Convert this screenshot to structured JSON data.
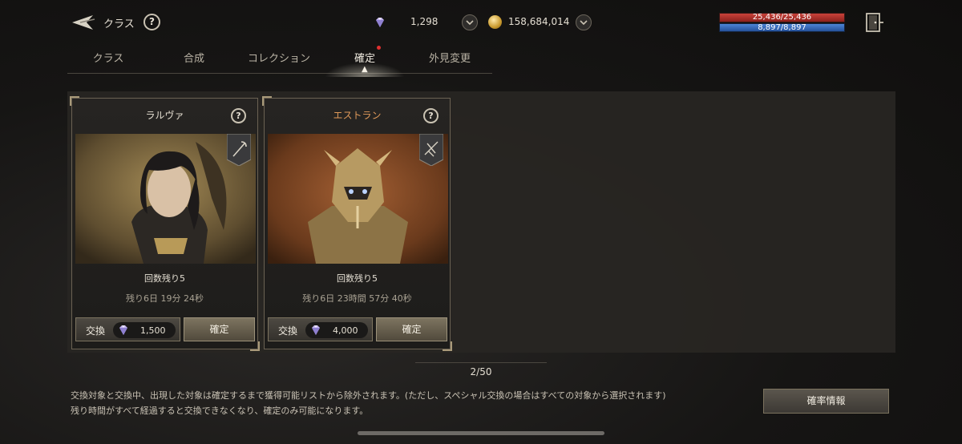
{
  "header": {
    "title": "クラス",
    "help": "?",
    "gems": "1,298",
    "gold": "158,684,014",
    "hp": "25,436/25,436",
    "mp": "8,897/8,897"
  },
  "tabs": [
    {
      "label": "クラス"
    },
    {
      "label": "合成"
    },
    {
      "label": "コレクション"
    },
    {
      "label": "確定"
    },
    {
      "label": "外見変更"
    }
  ],
  "active_tab": "確定",
  "cards": [
    {
      "name": "ラルヴァ",
      "help": "?",
      "remaining": "回数残り5",
      "timer": "残り6日 19分 24秒",
      "exchange_label": "交換",
      "price": "1,500",
      "confirm_label": "確定"
    },
    {
      "name": "エストラン",
      "help": "?",
      "remaining": "回数残り5",
      "timer": "残り6日 23時間 57分 40秒",
      "exchange_label": "交換",
      "price": "4,000",
      "confirm_label": "確定"
    }
  ],
  "pagination": "2/50",
  "notices": [
    "交換対象と交換中、出現した対象は確定するまで獲得可能リストから除外されます。(ただし、スペシャル交換の場合はすべての対象から選択されます)",
    "残り時間がすべて経過すると交換できなくなり、確定のみ可能になります。"
  ],
  "probability_button": "確率情報",
  "colors": {
    "hp": "#b8322b",
    "mp": "#3b6fc4",
    "rare_name": "#e09a5a",
    "tab_badge": "#e03030"
  }
}
